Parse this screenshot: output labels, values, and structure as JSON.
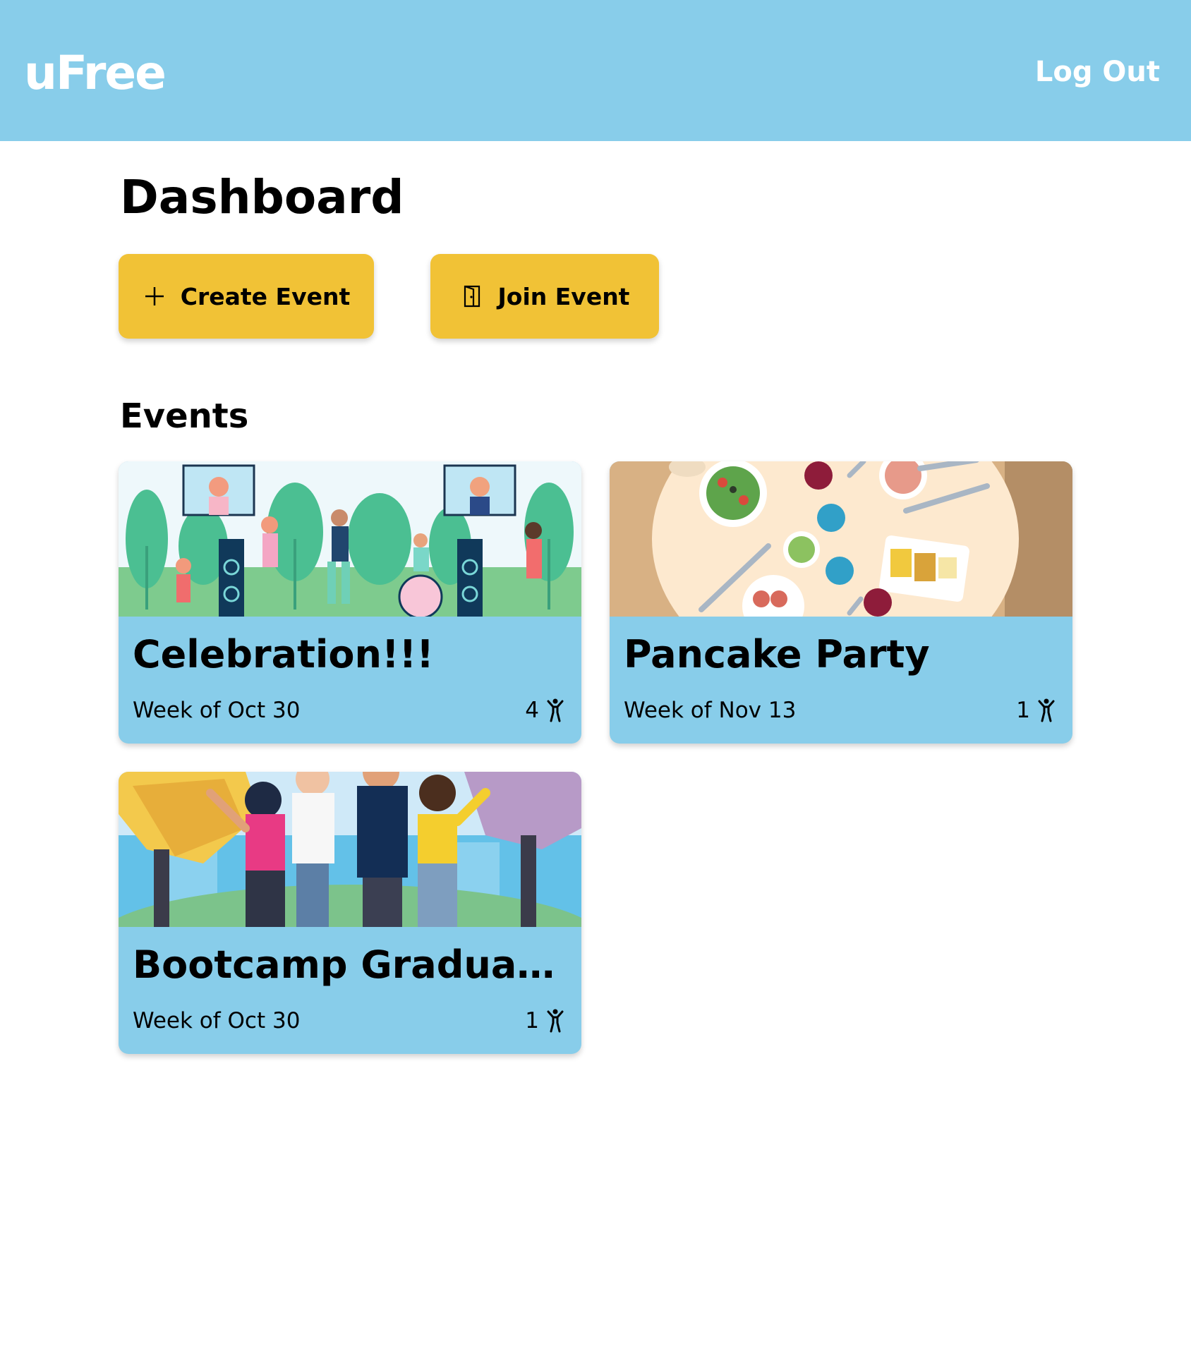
{
  "app": {
    "logo": "uFree",
    "logout_label": "Log Out"
  },
  "page": {
    "title": "Dashboard"
  },
  "actions": {
    "create_label": "Create Event",
    "create_icon": "plus-icon",
    "join_label": "Join Event",
    "join_icon": "door-icon"
  },
  "events_section": {
    "title": "Events",
    "items": [
      {
        "title": "Celebration!!!",
        "week": "Week of Oct 30",
        "count": "4",
        "image": "music-festival-illustration"
      },
      {
        "title": "Pancake Party",
        "week": "Week of Nov 13",
        "count": "1",
        "image": "dining-table-illustration"
      },
      {
        "title": "Bootcamp Graduation ...",
        "week": "Week of Oct 30",
        "count": "1",
        "image": "friends-celebrating-illustration"
      }
    ]
  },
  "colors": {
    "header": "#88cdea",
    "card": "#88cdea",
    "button": "#f1c236"
  }
}
